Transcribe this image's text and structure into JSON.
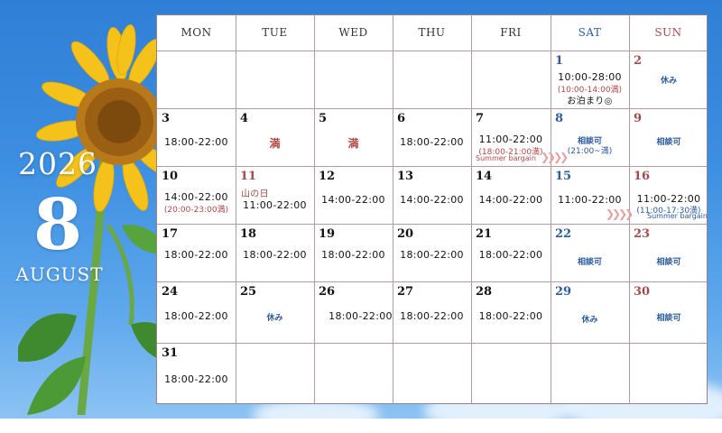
{
  "calendar": {
    "year": "2026",
    "month_number": "8",
    "month_name": "AUGUST",
    "weekdays": [
      "MON",
      "TUE",
      "WED",
      "THU",
      "FRI",
      "SAT",
      "SUN"
    ],
    "colors": {
      "saturday": "#2d5c9c",
      "sunday": "#a34a4a",
      "note_red": "#b04848",
      "grid": "#b79aa0"
    },
    "days": {
      "d1": {
        "num": "1",
        "time": "10:00-28:00",
        "note": "(10:00-14:00満)",
        "extra": "お泊まり◎"
      },
      "d2": {
        "num": "2",
        "label": "休み"
      },
      "d3": {
        "num": "3",
        "time": "18:00-22:00"
      },
      "d4": {
        "num": "4",
        "label": "満"
      },
      "d5": {
        "num": "5",
        "label": "満"
      },
      "d6": {
        "num": "6",
        "time": "18:00-22:00"
      },
      "d7": {
        "num": "7",
        "time": "11:00-22:00",
        "note": "(18:00-21:00満)",
        "bargain": "Summer bargain"
      },
      "d8": {
        "num": "8",
        "label": "相談可",
        "note": "(21:00~満)"
      },
      "d9": {
        "num": "9",
        "label": "相談可"
      },
      "d10": {
        "num": "10",
        "time": "14:00-22:00",
        "note": "(20:00-23:00満)"
      },
      "d11": {
        "num": "11",
        "holiday": "山の日",
        "time": "11:00-22:00"
      },
      "d12": {
        "num": "12",
        "time": "14:00-22:00"
      },
      "d13": {
        "num": "13",
        "time": "14:00-22:00"
      },
      "d14": {
        "num": "14",
        "time": "14:00-22:00"
      },
      "d15": {
        "num": "15",
        "time": "11:00-22:00"
      },
      "d16": {
        "num": "16",
        "time": "11:00-22:00",
        "note": "(11:00-17:30満)",
        "bargain": "Summer bargain"
      },
      "d17": {
        "num": "17",
        "time": "18:00-22:00"
      },
      "d18": {
        "num": "18",
        "time": "18:00-22:00"
      },
      "d19": {
        "num": "19",
        "time": "18:00-22:00"
      },
      "d20": {
        "num": "20",
        "time": "18:00-22:00"
      },
      "d21": {
        "num": "21",
        "time": "18:00-22:00"
      },
      "d22": {
        "num": "22",
        "label": "相談可"
      },
      "d23": {
        "num": "23",
        "label": "相談可"
      },
      "d24": {
        "num": "24",
        "time": "18:00-22:00"
      },
      "d25": {
        "num": "25",
        "label": "休み"
      },
      "d26": {
        "num": "26",
        "time": "18:00-22:00"
      },
      "d27": {
        "num": "27",
        "time": "18:00-22:00"
      },
      "d28": {
        "num": "28",
        "time": "18:00-22:00"
      },
      "d29": {
        "num": "29",
        "label": "休み"
      },
      "d30": {
        "num": "30",
        "label": "相談可"
      },
      "d31": {
        "num": "31",
        "time": "18:00-22:00"
      }
    },
    "arrow_glyph": "❯❯❯❯"
  }
}
